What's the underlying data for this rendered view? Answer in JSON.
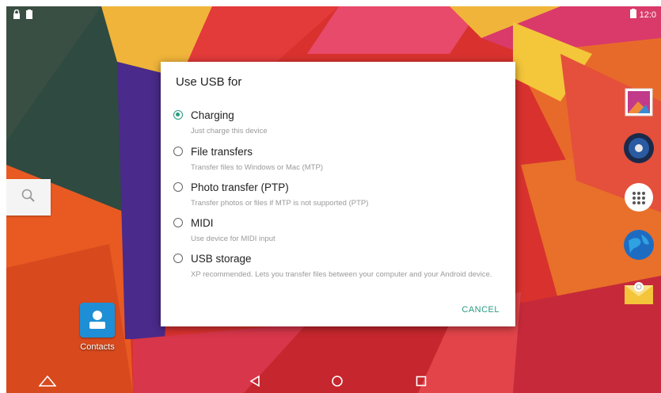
{
  "status_bar": {
    "time": "12:0",
    "left_icons": [
      "lock-icon",
      "clipboard-icon"
    ],
    "right_icons": [
      "battery-icon"
    ]
  },
  "dialog": {
    "title": "Use USB for",
    "options": [
      {
        "label": "Charging",
        "description": "Just charge this device",
        "selected": true
      },
      {
        "label": "File transfers",
        "description": "Transfer files to Windows or Mac (MTP)",
        "selected": false
      },
      {
        "label": "Photo transfer (PTP)",
        "description": "Transfer photos or files if MTP is not supported (PTP)",
        "selected": false
      },
      {
        "label": "MIDI",
        "description": "Use device for MIDI input",
        "selected": false
      },
      {
        "label": "USB storage",
        "description": "XP recommended. Lets you transfer files between your computer and your Android device.",
        "selected": false
      }
    ],
    "cancel_label": "CANCEL"
  },
  "home": {
    "contacts_label": "Contacts",
    "search_icon": "search-icon",
    "dock_icons": [
      "gallery-icon",
      "music-icon",
      "app-drawer-icon",
      "browser-globe-icon",
      "email-icon"
    ]
  },
  "nav_bar": {
    "icons": [
      "home-triangle-icon",
      "back-icon",
      "home-icon",
      "recents-icon"
    ]
  },
  "colors": {
    "accent": "#2a9a82",
    "contacts": "#1e8fd6"
  }
}
